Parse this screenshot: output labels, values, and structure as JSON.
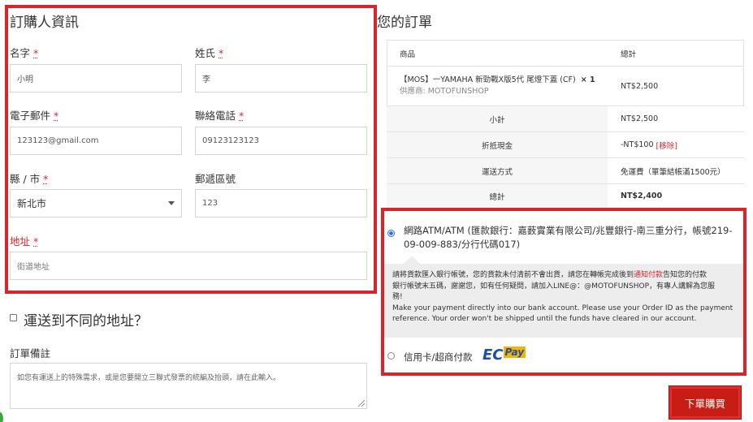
{
  "billing": {
    "title": "訂購人資訊",
    "first_name_label": "名字",
    "first_name_value": "小明",
    "last_name_label": "姓氏",
    "last_name_value": "李",
    "email_label": "電子郵件",
    "email_value": "123123@gmail.com",
    "phone_label": "聯絡電話",
    "phone_value": "09123123123",
    "city_label": "縣 / 市",
    "city_value": "新北市",
    "postcode_label": "郵遞區號",
    "postcode_value": "123",
    "address_label": "地址",
    "address_placeholder": "街道地址",
    "required_mark": "*"
  },
  "shipping": {
    "different_address_label": "運送到不同的地址？"
  },
  "notes": {
    "label": "訂單備註",
    "placeholder": "如您有運送上的特殊需求，或是您要開立三聯式發票的統編及抬頭，請在此輸入。"
  },
  "order": {
    "title": "您的訂單",
    "col_product": "商品",
    "col_subtotal": "總計",
    "product_name": "【MOS】一YAMAHA 新勁戰X版5代 尾燈下蓋 (CF)",
    "product_qty": "× 1",
    "supplier_label": "供應商:",
    "supplier_name": "MOTOFUNSHOP",
    "product_total": "NT$2,500",
    "subtotal_label": "小計",
    "subtotal_value": "NT$2,500",
    "discount_label": "折抵現金",
    "discount_value": "-NT$100",
    "discount_remove": "[移除]",
    "shipping_label": "運送方式",
    "shipping_value": "免運費（單筆結帳滿1500元）",
    "total_label": "總計",
    "total_value": "NT$2,400"
  },
  "payment": {
    "atm_label_line1": "網路ATM/ATM (匯款銀行：嘉薮實業有限公司/兆豐銀行-南三重分行，帳號219-",
    "atm_label_line2": "09-009-883/分行代碼017)",
    "desc_zh_line1_a": "請將貨款匯入銀行帳號，您的貨款未付清前不會出貨，請您在轉帳完成後到",
    "desc_zh_link": "通知付款",
    "desc_zh_line1_b": "告知您的付款",
    "desc_zh_line2": "銀行帳號末五碼，謝謝您，如有任何疑問，請加入LINE@：@MOTOFUNSHOP，有專人講解為您服",
    "desc_zh_line3": "務!",
    "desc_en_line1": "Make your payment directly into our bank account. Please use your Order ID as the payment",
    "desc_en_line2": "reference. Your order won't be shipped until the funds have cleared in our account.",
    "card_label": "信用卡/超商付款",
    "ecpay_ec": "EC",
    "ecpay_pay": "Pay"
  },
  "place_order_label": "下單購買",
  "colors": {
    "accent_red": "#d9242b",
    "button_red": "#c81d14",
    "radio_blue": "#2a6ef2",
    "ecpay_blue": "#1f4fa3",
    "ecpay_yellow": "#f4b400"
  }
}
